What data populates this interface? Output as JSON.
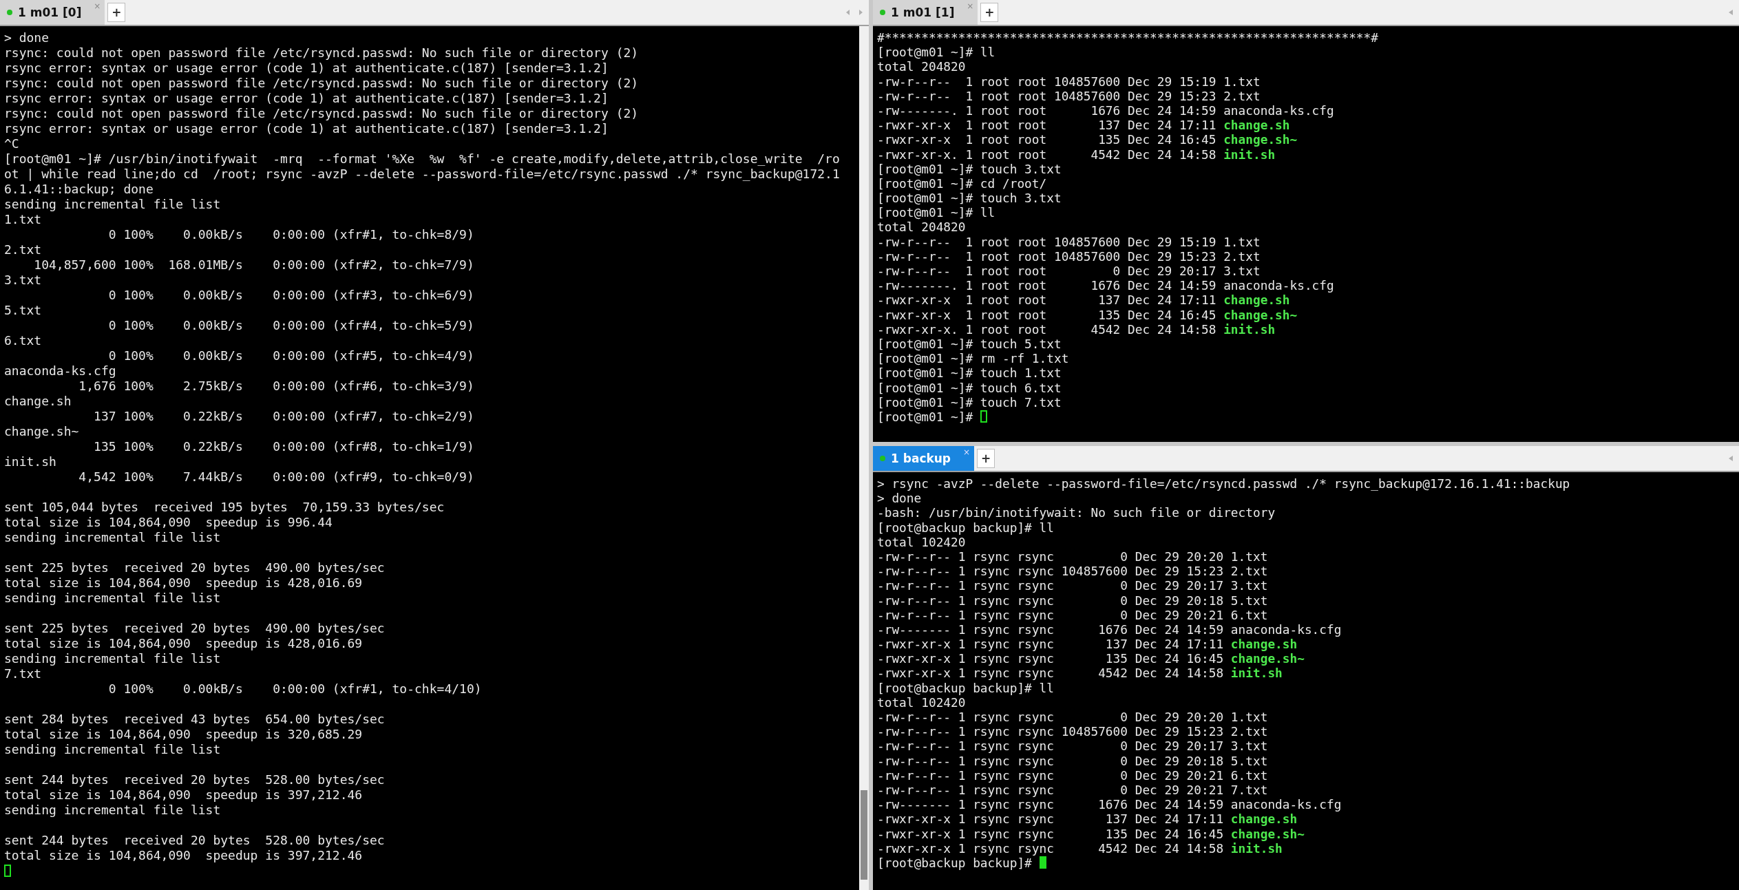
{
  "panes": [
    {
      "tab": {
        "label": "1 m01 [0]",
        "close": "×",
        "selected": true
      },
      "new_tab": "+",
      "focused": false,
      "scroll_arrows": true,
      "blocks": [
        {
          "lines": [
            {
              "text": "> done"
            },
            {
              "text": "rsync: could not open password file /etc/rsyncd.passwd: No such file or directory (2)"
            },
            {
              "text": "rsync error: syntax or usage error (code 1) at authenticate.c(187) [sender=3.1.2]"
            },
            {
              "text": "rsync: could not open password file /etc/rsyncd.passwd: No such file or directory (2)"
            },
            {
              "text": "rsync error: syntax or usage error (code 1) at authenticate.c(187) [sender=3.1.2]"
            },
            {
              "text": "rsync: could not open password file /etc/rsyncd.passwd: No such file or directory (2)"
            },
            {
              "text": "rsync error: syntax or usage error (code 1) at authenticate.c(187) [sender=3.1.2]"
            },
            {
              "text": "^C"
            },
            {
              "text": "[root@m01 ~]# /usr/bin/inotifywait  -mrq  --format '%Xe  %w  %f' -e create,modify,delete,attrib,close_write  /ro"
            },
            {
              "text": "ot | while read line;do cd  /root; rsync -avzP --delete --password-file=/etc/rsync.passwd ./* rsync_backup@172.1"
            },
            {
              "text": "6.1.41::backup; done"
            },
            {
              "text": "sending incremental file list"
            },
            {
              "text": "1.txt"
            },
            {
              "text": "              0 100%    0.00kB/s    0:00:00 (xfr#1, to-chk=8/9)"
            },
            {
              "text": "2.txt"
            },
            {
              "text": "    104,857,600 100%  168.01MB/s    0:00:00 (xfr#2, to-chk=7/9)"
            },
            {
              "text": "3.txt"
            },
            {
              "text": "              0 100%    0.00kB/s    0:00:00 (xfr#3, to-chk=6/9)"
            },
            {
              "text": "5.txt"
            },
            {
              "text": "              0 100%    0.00kB/s    0:00:00 (xfr#4, to-chk=5/9)"
            },
            {
              "text": "6.txt"
            },
            {
              "text": "              0 100%    0.00kB/s    0:00:00 (xfr#5, to-chk=4/9)"
            },
            {
              "text": "anaconda-ks.cfg"
            },
            {
              "text": "          1,676 100%    2.75kB/s    0:00:00 (xfr#6, to-chk=3/9)"
            },
            {
              "text": "change.sh"
            },
            {
              "text": "            137 100%    0.22kB/s    0:00:00 (xfr#7, to-chk=2/9)"
            },
            {
              "text": "change.sh~"
            },
            {
              "text": "            135 100%    0.22kB/s    0:00:00 (xfr#8, to-chk=1/9)"
            },
            {
              "text": "init.sh"
            },
            {
              "text": "          4,542 100%    7.44kB/s    0:00:00 (xfr#9, to-chk=0/9)"
            }
          ]
        },
        {
          "lines": [
            {
              "text": "sent 105,044 bytes  received 195 bytes  70,159.33 bytes/sec"
            },
            {
              "text": "total size is 104,864,090  speedup is 996.44"
            },
            {
              "text": "sending incremental file list"
            }
          ]
        },
        {
          "lines": [
            {
              "text": "sent 225 bytes  received 20 bytes  490.00 bytes/sec"
            },
            {
              "text": "total size is 104,864,090  speedup is 428,016.69"
            },
            {
              "text": "sending incremental file list"
            }
          ]
        },
        {
          "lines": [
            {
              "text": "sent 225 bytes  received 20 bytes  490.00 bytes/sec"
            },
            {
              "text": "total size is 104,864,090  speedup is 428,016.69"
            },
            {
              "text": "sending incremental file list"
            },
            {
              "text": "7.txt"
            },
            {
              "text": "              0 100%    0.00kB/s    0:00:00 (xfr#1, to-chk=4/10)"
            }
          ]
        },
        {
          "lines": [
            {
              "text": "sent 284 bytes  received 43 bytes  654.00 bytes/sec"
            },
            {
              "text": "total size is 104,864,090  speedup is 320,685.29"
            },
            {
              "text": "sending incremental file list"
            }
          ]
        },
        {
          "lines": [
            {
              "text": "sent 244 bytes  received 20 bytes  528.00 bytes/sec"
            },
            {
              "text": "total size is 104,864,090  speedup is 397,212.46"
            },
            {
              "text": "sending incremental file list"
            }
          ]
        },
        {
          "lines": [
            {
              "text": "sent 244 bytes  received 20 bytes  528.00 bytes/sec"
            },
            {
              "text": "total size is 104,864,090  speedup is 397,212.46"
            },
            {
              "cursor": true
            }
          ]
        }
      ]
    },
    {
      "tab": {
        "label": "1 m01 [1]",
        "close": "×",
        "selected": true
      },
      "new_tab": "+",
      "focused": false,
      "scroll_arrows": false,
      "blocks": [
        {
          "lines": [
            {
              "text": "#******************************************************************#"
            },
            {
              "text": "[root@m01 ~]# ll"
            },
            {
              "text": "total 204820"
            },
            {
              "text": "-rw-r--r--  1 root root 104857600 Dec 29 15:19 1.txt"
            },
            {
              "text": "-rw-r--r--  1 root root 104857600 Dec 29 15:23 2.txt"
            },
            {
              "text": "-rw-------. 1 root root      1676 Dec 24 14:59 anaconda-ks.cfg"
            },
            {
              "text": "-rwxr-xr-x  1 root root       137 Dec 24 17:11 ",
              "executable": "change.sh"
            },
            {
              "text": "-rwxr-xr-x  1 root root       135 Dec 24 16:45 ",
              "executable": "change.sh~"
            },
            {
              "text": "-rwxr-xr-x. 1 root root      4542 Dec 24 14:58 ",
              "executable": "init.sh"
            },
            {
              "text": "[root@m01 ~]# touch 3.txt"
            },
            {
              "text": "[root@m01 ~]# cd /root/"
            },
            {
              "text": "[root@m01 ~]# touch 3.txt"
            },
            {
              "text": "[root@m01 ~]# ll"
            },
            {
              "text": "total 204820"
            },
            {
              "text": "-rw-r--r--  1 root root 104857600 Dec 29 15:19 1.txt"
            },
            {
              "text": "-rw-r--r--  1 root root 104857600 Dec 29 15:23 2.txt"
            },
            {
              "text": "-rw-r--r--  1 root root         0 Dec 29 20:17 3.txt"
            },
            {
              "text": "-rw-------. 1 root root      1676 Dec 24 14:59 anaconda-ks.cfg"
            },
            {
              "text": "-rwxr-xr-x  1 root root       137 Dec 24 17:11 ",
              "executable": "change.sh"
            },
            {
              "text": "-rwxr-xr-x  1 root root       135 Dec 24 16:45 ",
              "executable": "change.sh~"
            },
            {
              "text": "-rwxr-xr-x. 1 root root      4542 Dec 24 14:58 ",
              "executable": "init.sh"
            },
            {
              "text": "[root@m01 ~]# touch 5.txt"
            },
            {
              "text": "[root@m01 ~]# rm -rf 1.txt"
            },
            {
              "text": "[root@m01 ~]# touch 1.txt"
            },
            {
              "text": "[root@m01 ~]# touch 6.txt"
            },
            {
              "text": "[root@m01 ~]# touch 7.txt"
            },
            {
              "text": "[root@m01 ~]# ",
              "cursor": true
            }
          ]
        }
      ]
    },
    {
      "tab": {
        "label": "1 backup",
        "close": "×",
        "selected": true
      },
      "new_tab": "+",
      "focused": true,
      "scroll_arrows": false,
      "blocks": [
        {
          "lines": [
            {
              "text": "> rsync -avzP --delete --password-file=/etc/rsyncd.passwd ./* rsync_backup@172.16.1.41::backup"
            },
            {
              "text": "> done"
            },
            {
              "text": "-bash: /usr/bin/inotifywait: No such file or directory"
            },
            {
              "text": "[root@backup backup]# ll"
            },
            {
              "text": "total 102420"
            },
            {
              "text": "-rw-r--r-- 1 rsync rsync         0 Dec 29 20:20 1.txt"
            },
            {
              "text": "-rw-r--r-- 1 rsync rsync 104857600 Dec 29 15:23 2.txt"
            },
            {
              "text": "-rw-r--r-- 1 rsync rsync         0 Dec 29 20:17 3.txt"
            },
            {
              "text": "-rw-r--r-- 1 rsync rsync         0 Dec 29 20:18 5.txt"
            },
            {
              "text": "-rw-r--r-- 1 rsync rsync         0 Dec 29 20:21 6.txt"
            },
            {
              "text": "-rw------- 1 rsync rsync      1676 Dec 24 14:59 anaconda-ks.cfg"
            },
            {
              "text": "-rwxr-xr-x 1 rsync rsync       137 Dec 24 17:11 ",
              "executable": "change.sh"
            },
            {
              "text": "-rwxr-xr-x 1 rsync rsync       135 Dec 24 16:45 ",
              "executable": "change.sh~"
            },
            {
              "text": "-rwxr-xr-x 1 rsync rsync      4542 Dec 24 14:58 ",
              "executable": "init.sh"
            },
            {
              "text": "[root@backup backup]# ll"
            },
            {
              "text": "total 102420"
            },
            {
              "text": "-rw-r--r-- 1 rsync rsync         0 Dec 29 20:20 1.txt"
            },
            {
              "text": "-rw-r--r-- 1 rsync rsync 104857600 Dec 29 15:23 2.txt"
            },
            {
              "text": "-rw-r--r-- 1 rsync rsync         0 Dec 29 20:17 3.txt"
            },
            {
              "text": "-rw-r--r-- 1 rsync rsync         0 Dec 29 20:18 5.txt"
            },
            {
              "text": "-rw-r--r-- 1 rsync rsync         0 Dec 29 20:21 6.txt"
            },
            {
              "text": "-rw-r--r-- 1 rsync rsync         0 Dec 29 20:21 7.txt"
            },
            {
              "text": "-rw------- 1 rsync rsync      1676 Dec 24 14:59 anaconda-ks.cfg"
            },
            {
              "text": "-rwxr-xr-x 1 rsync rsync       137 Dec 24 17:11 ",
              "executable": "change.sh"
            },
            {
              "text": "-rwxr-xr-x 1 rsync rsync       135 Dec 24 16:45 ",
              "executable": "change.sh~"
            },
            {
              "text": "-rwxr-xr-x 1 rsync rsync      4542 Dec 24 14:58 ",
              "executable": "init.sh"
            },
            {
              "text": "[root@backup backup]# ",
              "cursor": true
            }
          ]
        }
      ]
    }
  ]
}
